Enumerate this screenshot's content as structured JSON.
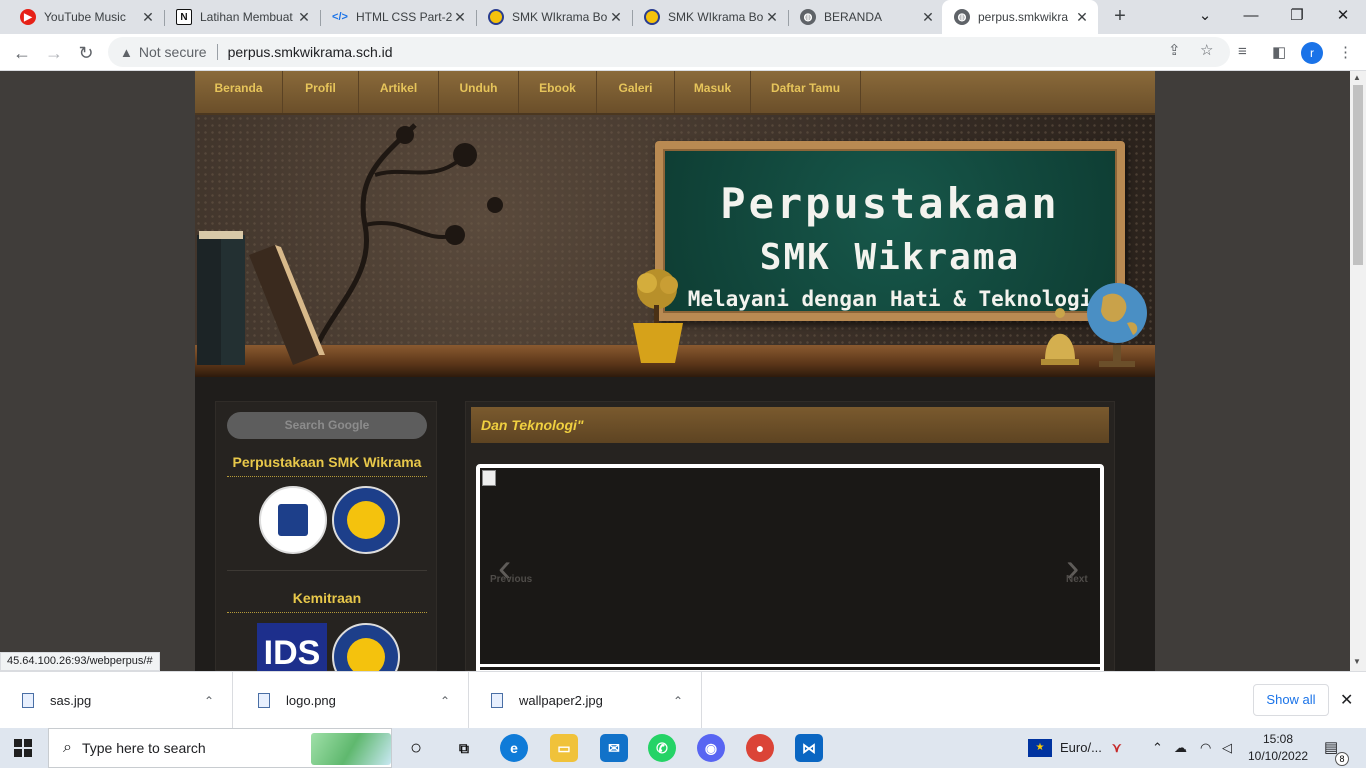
{
  "browser": {
    "tabs": [
      {
        "title": "YouTube Music",
        "icon": "youtube-music-icon"
      },
      {
        "title": "Latihan Membuat",
        "icon": "notion-icon"
      },
      {
        "title": "HTML CSS Part-2",
        "icon": "code-icon"
      },
      {
        "title": "SMK WIkrama Bo",
        "icon": "wikrama-logo-icon"
      },
      {
        "title": "SMK WIkrama Bo",
        "icon": "wikrama-logo-icon"
      },
      {
        "title": "BERANDA",
        "icon": "globe-icon"
      },
      {
        "title": "perpus.smkwikra",
        "icon": "globe-icon",
        "active": true
      }
    ],
    "omnibox": {
      "security": "Not secure",
      "url": "perpus.smkwikrama.sch.id"
    },
    "profile_initial": "r",
    "status_url": "45.64.100.26:93/webperpus/#"
  },
  "site": {
    "nav": [
      "Beranda",
      "Profil",
      "Artikel",
      "Unduh",
      "Ebook",
      "Galeri",
      "Masuk",
      "Daftar Tamu"
    ],
    "banner": {
      "line1": "Perpustakaan",
      "line2": "SMK Wikrama",
      "line3": "Melayani dengan Hati & Teknologi"
    },
    "sidebar": {
      "search_placeholder": "Search Google",
      "section1_title": "Perpustakaan SMK Wikrama",
      "section2_title": "Kemitraan",
      "ids_logo_text": "IDS"
    },
    "main": {
      "heading": "Dan Teknologi\"",
      "slider_prev": "Previous",
      "slider_next": "Next"
    }
  },
  "downloads": {
    "items": [
      "sas.jpg",
      "logo.png",
      "wallpaper2.jpg"
    ],
    "show_all": "Show all"
  },
  "taskbar": {
    "search_placeholder": "Type here to search",
    "language": "Euro/...",
    "time": "15:08",
    "date": "10/10/2022",
    "notification_count": "8"
  },
  "colors": {
    "accent_gold": "#e8c84a",
    "chalkboard": "#0e3d33",
    "browser_blue": "#1a73e8"
  }
}
